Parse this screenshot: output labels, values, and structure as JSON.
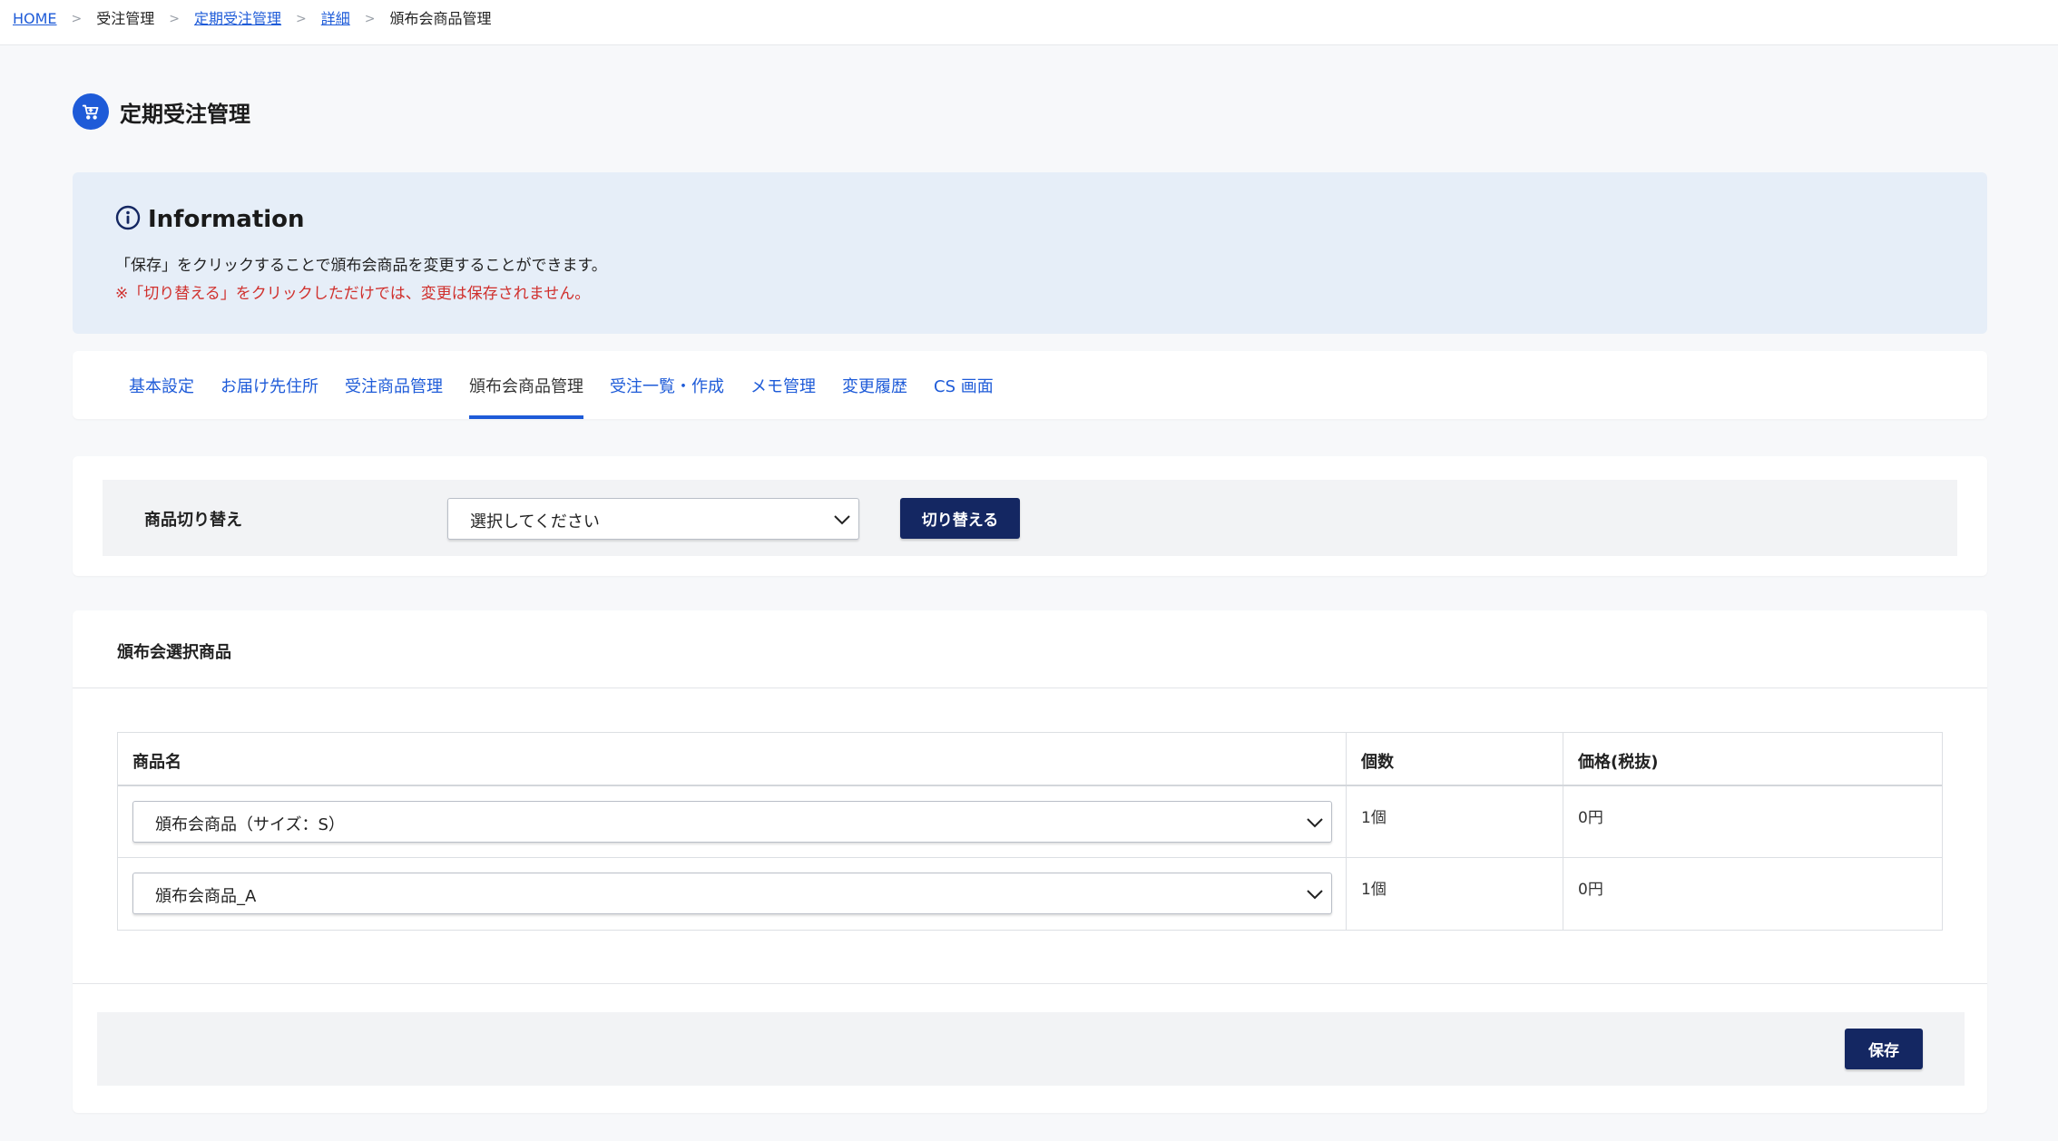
{
  "breadcrumb": {
    "home": "HOME",
    "order_mgmt": "受注管理",
    "subscription_mgmt": "定期受注管理",
    "detail": "詳細",
    "current": "頒布会商品管理",
    "separator": ">"
  },
  "page": {
    "title": "定期受注管理",
    "icon": "cart-icon"
  },
  "info": {
    "icon": "info-circle-icon",
    "title": "Information",
    "line1": "「保存」をクリックすることで頒布会商品を変更することができます。",
    "line2": "※「切り替える」をクリックしただけでは、変更は保存されません。"
  },
  "tabs": [
    {
      "label": "基本設定",
      "active": false
    },
    {
      "label": "お届け先住所",
      "active": false
    },
    {
      "label": "受注商品管理",
      "active": false
    },
    {
      "label": "頒布会商品管理",
      "active": true
    },
    {
      "label": "受注一覧・作成",
      "active": false
    },
    {
      "label": "メモ管理",
      "active": false
    },
    {
      "label": "変更履歴",
      "active": false
    },
    {
      "label": "CS 画面",
      "active": false
    }
  ],
  "switch": {
    "label": "商品切り替え",
    "select_value": "選択してください",
    "button": "切り替える"
  },
  "products": {
    "heading": "頒布会選択商品",
    "columns": [
      "商品名",
      "個数",
      "価格(税抜)"
    ],
    "rows": [
      {
        "name": "頒布会商品（サイズ：S）",
        "qty": "1個",
        "price": "0円"
      },
      {
        "name": "頒布会商品_A",
        "qty": "1個",
        "price": "0円"
      }
    ],
    "save": "保存"
  },
  "colors": {
    "accent": "#1e5bd8",
    "navy": "#142762",
    "info_bg": "#e6eef8",
    "warning": "#d0302d"
  }
}
